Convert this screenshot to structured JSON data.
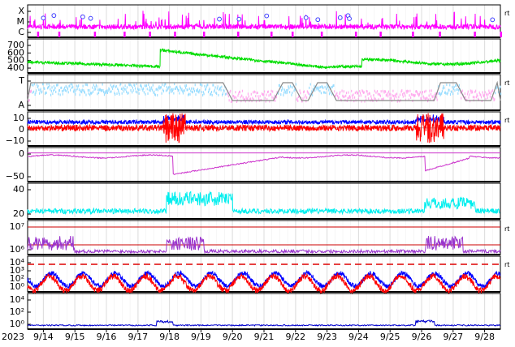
{
  "chart_data": {
    "type": "line",
    "x_axis": {
      "year_label": "2023",
      "date_start": "2023-09-13T12:00",
      "date_end": "2023-09-28T12:00",
      "tick_labels": [
        "9/14",
        "9/15",
        "9/16",
        "9/17",
        "9/18",
        "9/19",
        "9/20",
        "9/21",
        "9/22",
        "9/23",
        "9/24",
        "9/25",
        "9/26",
        "9/27",
        "9/28"
      ]
    },
    "panels": [
      {
        "id": "xray-flare",
        "y_tick_labels": [
          "X",
          "M",
          "C"
        ],
        "right_label": "rt",
        "series": [
          {
            "color": "#ff00ff"
          }
        ],
        "flare_marker_color": "#4040ff",
        "flare_markers_at": [
          "2023-09-14T00:00",
          "2023-09-14T08:00",
          "2023-09-15T06:00",
          "2023-09-15T12:00",
          "2023-09-19T14:00",
          "2023-09-20T05:00",
          "2023-09-21T02:00",
          "2023-09-22T08:00",
          "2023-09-22T17:00",
          "2023-09-23T10:00",
          "2023-09-23T16:00",
          "2023-09-23T17:00",
          "2023-09-28T06:00"
        ]
      },
      {
        "id": "solar-wind-speed",
        "y_tick_labels": [
          "700",
          "600",
          "500",
          "400"
        ],
        "y_range": [
          350,
          720
        ],
        "series": [
          {
            "color": "#00dd00"
          }
        ]
      },
      {
        "id": "sector-polarity",
        "y_tick_labels": [
          "T",
          "A"
        ],
        "right_label": "rt",
        "series": [
          {
            "color": "#99ddff"
          },
          {
            "color": "#ffaaee"
          },
          {
            "color": "#888888"
          }
        ]
      },
      {
        "id": "imf",
        "y_tick_labels": [
          "10",
          "0",
          "−10"
        ],
        "y_range": [
          -18,
          16
        ],
        "right_label": "rt",
        "series": [
          {
            "color": "#0000ff"
          },
          {
            "color": "#ff0000"
          }
        ]
      },
      {
        "id": "dst",
        "y_tick_labels": [
          "0",
          "−50"
        ],
        "y_range": [
          -80,
          15
        ],
        "series": [
          {
            "color": "#cc33cc"
          }
        ]
      },
      {
        "id": "ae",
        "y_tick_labels": [
          "40",
          "20"
        ],
        "y_range": [
          0,
          55
        ],
        "series": [
          {
            "color": "#00eeee"
          }
        ]
      },
      {
        "id": "proton",
        "y_tick_labels": [
          "10⁷",
          "10⁶"
        ],
        "right_label": "rt",
        "threshold_color": "#cc0000",
        "series": [
          {
            "color": "#9933cc"
          }
        ]
      },
      {
        "id": "electron-flux",
        "y_tick_labels": [
          "10⁴",
          "10³",
          "10²",
          "10⁰"
        ],
        "right_label": "rt",
        "threshold_color": "#dd0000",
        "series": [
          {
            "color": "#0000ff"
          },
          {
            "color": "#ff0000"
          }
        ]
      },
      {
        "id": "electron-low",
        "y_tick_labels": [
          "10⁴",
          "10²",
          "10⁰"
        ],
        "series": [
          {
            "color": "#0000cc"
          }
        ]
      }
    ]
  }
}
